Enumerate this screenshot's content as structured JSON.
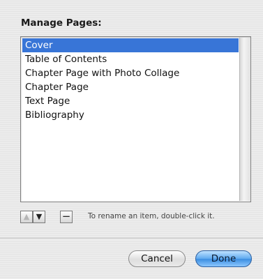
{
  "dialog": {
    "title": "Manage Pages:",
    "pages": [
      {
        "label": "Cover",
        "selected": true
      },
      {
        "label": "Table of Contents",
        "selected": false
      },
      {
        "label": "Chapter Page with Photo Collage",
        "selected": false
      },
      {
        "label": "Chapter Page",
        "selected": false
      },
      {
        "label": "Text Page",
        "selected": false
      },
      {
        "label": "Bibliography",
        "selected": false
      }
    ],
    "controls": {
      "move_up_icon": "arrow-up-icon",
      "move_down_icon": "arrow-down-icon",
      "remove_label": "−",
      "hint": "To rename an item, double-click it."
    },
    "buttons": {
      "cancel": "Cancel",
      "done": "Done"
    }
  },
  "colors": {
    "selection": "#3875d7",
    "default_button": "#5ea9ef"
  }
}
